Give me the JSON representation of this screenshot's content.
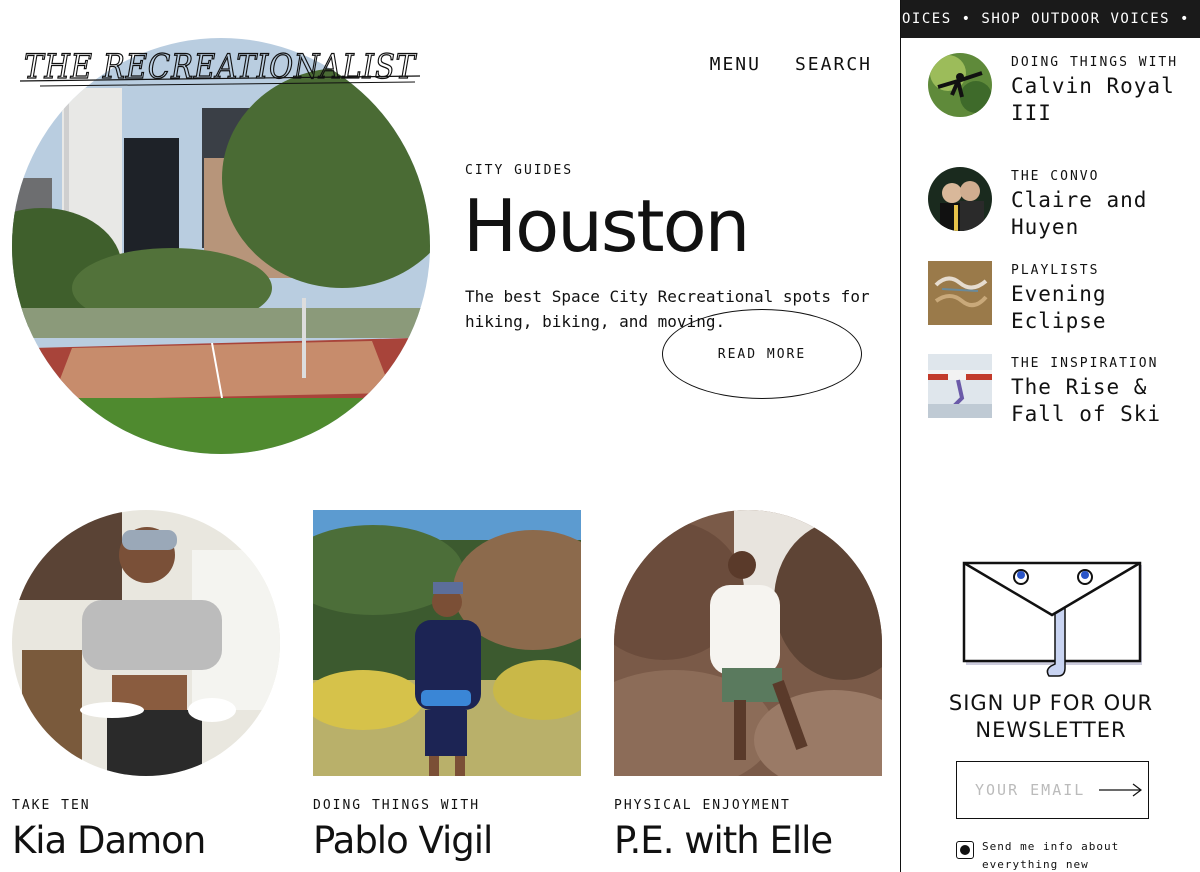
{
  "brand": {
    "logo_text": "THE RECREATIONALIST"
  },
  "nav": {
    "menu": "MENU",
    "search": "SEARCH"
  },
  "hero": {
    "category": "CITY GUIDES",
    "title": "Houston",
    "description": "The best Space City Recreational spots for hiking, biking, and moving.",
    "read_more": "READ MORE"
  },
  "cards": [
    {
      "category": "TAKE TEN",
      "title": "Kia Damon"
    },
    {
      "category": "DOING THINGS WITH",
      "title": "Pablo Vigil"
    },
    {
      "category": "PHYSICAL ENJOYMENT",
      "title": "P.E. with Elle"
    }
  ],
  "sidebar": {
    "ticker": "OICES • SHOP OUTDOOR VOICES • S",
    "items": [
      {
        "category": "DOING THINGS WITH",
        "title": "Calvin Royal III"
      },
      {
        "category": "THE CONVO",
        "title": "Claire and Huyen"
      },
      {
        "category": "PLAYLISTS",
        "title": "Evening Eclipse"
      },
      {
        "category": "THE INSPIRATION",
        "title": "The Rise & Fall of Ski"
      }
    ],
    "newsletter": {
      "title": "SIGN UP FOR OUR NEWSLETTER",
      "email_placeholder": "YOUR EMAIL",
      "opt_in_text": "Send me info about everything new"
    }
  }
}
